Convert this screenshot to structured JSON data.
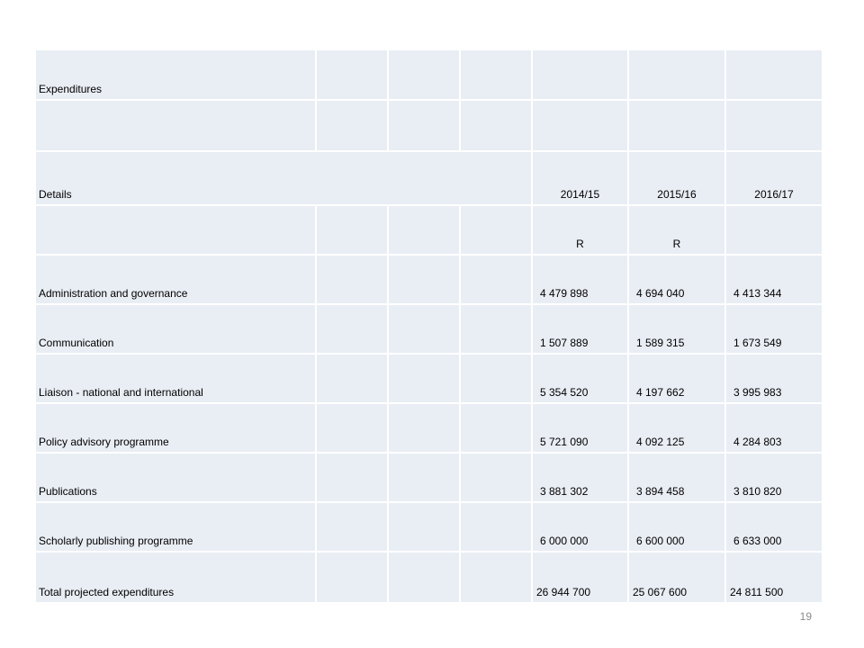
{
  "table": {
    "title": "Expenditures",
    "header": {
      "details": "Details",
      "years": [
        "2014/15",
        "2015/16",
        "2016/17"
      ],
      "currency": [
        "R",
        "R"
      ]
    },
    "rows": [
      {
        "label": "Administration and governance",
        "values": [
          "4 479 898",
          "4 694 040",
          "4 413 344"
        ]
      },
      {
        "label": "Communication",
        "values": [
          "1 507 889",
          "1 589 315",
          "1 673 549"
        ]
      },
      {
        "label": "Liaison - national and international",
        "values": [
          "5 354 520",
          "4 197 662",
          "3 995 983"
        ]
      },
      {
        "label": "Policy advisory programme",
        "values": [
          "5 721 090",
          "4 092 125",
          "4 284 803"
        ]
      },
      {
        "label": "Publications",
        "values": [
          "3 881 302",
          "3 894 458",
          "3 810 820"
        ]
      },
      {
        "label": "Scholarly publishing programme",
        "values": [
          "6 000 000",
          "6 600 000",
          "6 633 000"
        ]
      }
    ],
    "total": {
      "label": "Total projected expenditures",
      "values": [
        "26 944 700",
        "25 067 600",
        "24 811 500"
      ]
    }
  },
  "page_number": "19"
}
